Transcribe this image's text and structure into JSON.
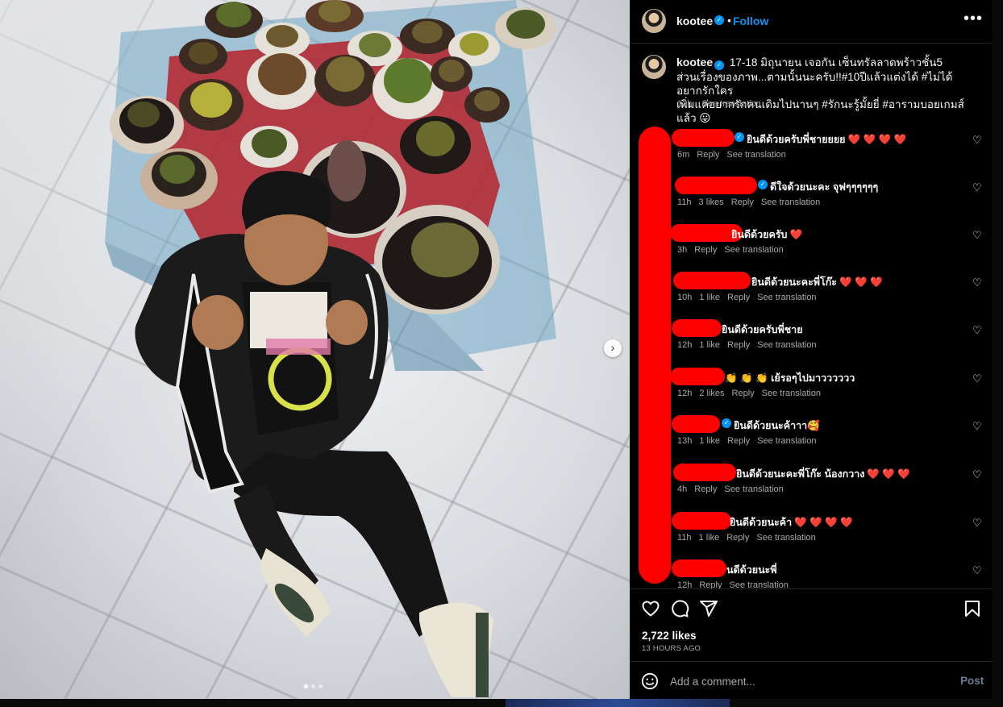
{
  "post": {
    "username": "kootee",
    "follow_label": "Follow",
    "bullet": "•",
    "more_label": "•••",
    "verified_icon": "✓",
    "caption_lines": [
      "17-18 มิถุนายน เจอกัน เซ็นทรัลลาดพร้าวชั้น5",
      "ส่วนเรื่องของภาพ...ตามนั้นนะครับ!!#10ปีแล้วแต่งได้ #ไม่ได้อยากรักใคร",
      "เพิ่มแค่อยากรักคนเดิมไปนานๆ #รักนะรู้มั้ยยี่ #อารามบอยเกมส์แล้ว 😛"
    ],
    "caption_time": "13h",
    "see_translation": "See translation",
    "carousel_next_icon": "chevron-right-icon",
    "carousel_next_glyph": "›",
    "likes": "2,722 likes",
    "time_ago": "13 HOURS AGO",
    "comment_placeholder": "Add a comment...",
    "post_label": "Post"
  },
  "comments": [
    {
      "text": "ยินดีด้วยครับพี่ชายยยย",
      "hearts": "❤️ ❤️ ❤️ ❤️",
      "time": "6m",
      "likes": "",
      "reply": "Reply",
      "translate": "See translation"
    },
    {
      "text": "ดีใจด้วยนะคะ จุฟๆๆๆๆๆๆ",
      "hearts": "",
      "time": "11h",
      "likes": "3 likes",
      "reply": "Reply",
      "translate": "See translation"
    },
    {
      "text": "ยินดีด้วยครับ",
      "hearts": "❤️",
      "time": "3h",
      "likes": "",
      "reply": "Reply",
      "translate": "See translation"
    },
    {
      "text": "ยินดีด้วยนะคะพี่โก๊ะ",
      "hearts": "❤️ ❤️ ❤️",
      "time": "10h",
      "likes": "1 like",
      "reply": "Reply",
      "translate": "See translation"
    },
    {
      "text": "ยินดีด้วยครับพี่ชาย",
      "hearts": "",
      "time": "12h",
      "likes": "1 like",
      "reply": "Reply",
      "translate": "See translation"
    },
    {
      "text": "👏 👏 👏 เย้รอๆไปมาวววววว",
      "hearts": "",
      "time": "12h",
      "likes": "2 likes",
      "reply": "Reply",
      "translate": "See translation"
    },
    {
      "text": "ยินดีด้วยนะค้าาา🥰",
      "hearts": "",
      "time": "13h",
      "likes": "1 like",
      "reply": "Reply",
      "translate": "See translation"
    },
    {
      "text": "ยินดีด้วยนะคะพี่โก๊ะ น้องกวาง",
      "hearts": "❤️ ❤️ ❤️",
      "time": "4h",
      "likes": "",
      "reply": "Reply",
      "translate": "See translation"
    },
    {
      "text": "ยินดีด้วยนะค้า",
      "hearts": "❤️ ❤️ ❤️ ❤️",
      "time": "11h",
      "likes": "1 like",
      "reply": "Reply",
      "translate": "See translation"
    },
    {
      "text": "นดีด้วยนะพี่",
      "hearts": "",
      "time": "12h",
      "likes": "",
      "reply": "Reply",
      "translate": "See translation"
    }
  ],
  "icons": {
    "like": "heart-icon",
    "comment": "comment-icon",
    "share": "share-icon",
    "save": "bookmark-icon",
    "emoji": "emoji-icon"
  },
  "colors": {
    "background": "#000000",
    "link_blue": "#0095f6",
    "secondary_text": "#a8a8a8",
    "redaction_red": "#ff0000",
    "divider": "#262626"
  }
}
